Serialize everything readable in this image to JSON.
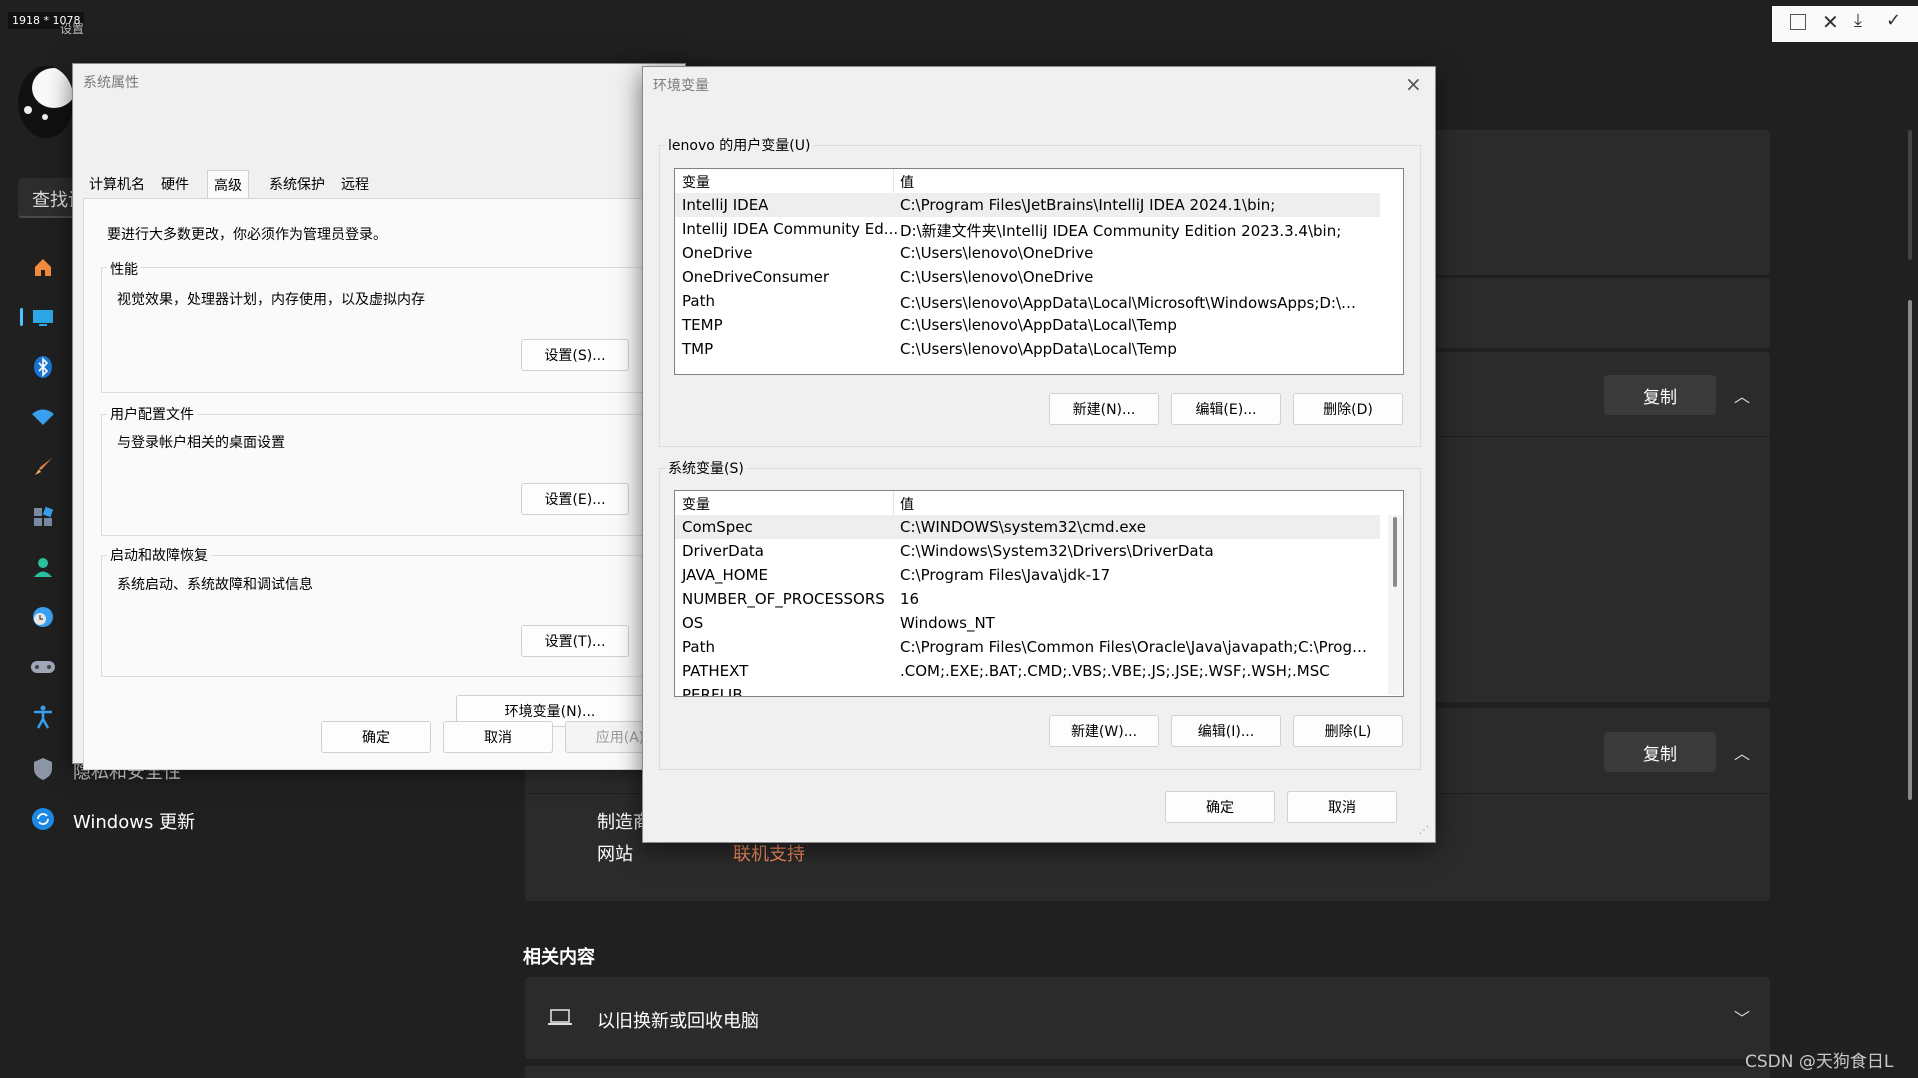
{
  "overlay": {
    "dims": "1918 * 1078",
    "window_title": "设置"
  },
  "settings": {
    "search_placeholder": "查找设置",
    "sidebar": [
      {
        "icon": "home-icon",
        "label": ""
      },
      {
        "icon": "display-icon",
        "label": ""
      },
      {
        "icon": "bluetooth-icon",
        "label": ""
      },
      {
        "icon": "wifi-icon",
        "label": ""
      },
      {
        "icon": "brush-icon",
        "label": ""
      },
      {
        "icon": "apps-icon",
        "label": ""
      },
      {
        "icon": "account-icon",
        "label": ""
      },
      {
        "icon": "clock-icon",
        "label": ""
      },
      {
        "icon": "gamepad-icon",
        "label": ""
      },
      {
        "icon": "accessibility-icon",
        "label": ""
      },
      {
        "icon": "shield-icon",
        "label": "隐私和安全性"
      },
      {
        "icon": "update-icon",
        "label": "Windows 更新"
      }
    ],
    "copy_label": "复制",
    "support": {
      "manufacturer": "制造商",
      "website": "网站",
      "link": "联机支持"
    },
    "related_heading": "相关内容",
    "related_item": "以旧换新或回收电脑",
    "watermark": "CSDN @天狗食日L"
  },
  "sysprop": {
    "title": "系统属性",
    "tabs": [
      "计算机名",
      "硬件",
      "高级",
      "系统保护",
      "远程"
    ],
    "notice": "要进行大多数更改，你必须作为管理员登录。",
    "performance": {
      "title": "性能",
      "desc": "视觉效果，处理器计划，内存使用，以及虚拟内存",
      "button": "设置(S)..."
    },
    "profile": {
      "title": "用户配置文件",
      "desc": "与登录帐户相关的桌面设置",
      "button": "设置(E)..."
    },
    "startup": {
      "title": "启动和故障恢复",
      "desc": "系统启动、系统故障和调试信息",
      "button": "设置(T)..."
    },
    "env_button": "环境变量(N)...",
    "ok": "确定",
    "cancel": "取消",
    "apply": "应用(A)"
  },
  "envvar": {
    "title": "环境变量",
    "close": "×",
    "user_group": "lenovo 的用户变量(U)",
    "col_var": "变量",
    "col_val": "值",
    "user_vars": [
      {
        "name": "IntelliJ IDEA",
        "value": "C:\\Program Files\\JetBrains\\IntelliJ IDEA 2024.1\\bin;"
      },
      {
        "name": "IntelliJ IDEA Community Ed...",
        "value": "D:\\新建文件夹\\IntelliJ IDEA Community Edition 2023.3.4\\bin;"
      },
      {
        "name": "OneDrive",
        "value": "C:\\Users\\lenovo\\OneDrive"
      },
      {
        "name": "OneDriveConsumer",
        "value": "C:\\Users\\lenovo\\OneDrive"
      },
      {
        "name": "Path",
        "value": "C:\\Users\\lenovo\\AppData\\Local\\Microsoft\\WindowsApps;D:\\代..."
      },
      {
        "name": "TEMP",
        "value": "C:\\Users\\lenovo\\AppData\\Local\\Temp"
      },
      {
        "name": "TMP",
        "value": "C:\\Users\\lenovo\\AppData\\Local\\Temp"
      }
    ],
    "user_buttons": {
      "new": "新建(N)...",
      "edit": "编辑(E)...",
      "delete": "删除(D)"
    },
    "sys_group": "系统变量(S)",
    "sys_vars": [
      {
        "name": "ComSpec",
        "value": "C:\\WINDOWS\\system32\\cmd.exe"
      },
      {
        "name": "DriverData",
        "value": "C:\\Windows\\System32\\Drivers\\DriverData"
      },
      {
        "name": "JAVA_HOME",
        "value": "C:\\Program Files\\Java\\jdk-17"
      },
      {
        "name": "NUMBER_OF_PROCESSORS",
        "value": "16"
      },
      {
        "name": "OS",
        "value": "Windows_NT"
      },
      {
        "name": "Path",
        "value": "C:\\Program Files\\Common Files\\Oracle\\Java\\javapath;C:\\Progra..."
      },
      {
        "name": "PATHEXT",
        "value": ".COM;.EXE;.BAT;.CMD;.VBS;.VBE;.JS;.JSE;.WSF;.WSH;.MSC"
      },
      {
        "name": "PERFLIB",
        "value": ""
      }
    ],
    "sys_buttons": {
      "new": "新建(W)...",
      "edit": "编辑(I)...",
      "delete": "删除(L)"
    },
    "ok": "确定",
    "cancel": "取消"
  }
}
